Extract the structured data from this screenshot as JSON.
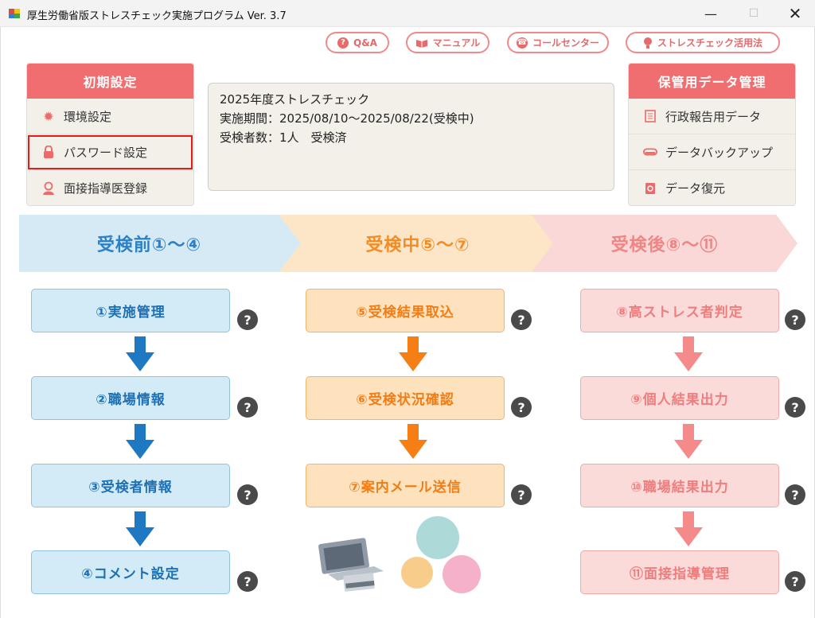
{
  "window": {
    "title": "厚生労働省版ストレスチェック実施プログラム Ver. 3.7",
    "minimize": "—",
    "maximize": "☐",
    "close": "✕"
  },
  "help_links": [
    {
      "label": "Q&A",
      "icon": "question-icon"
    },
    {
      "label": "マニュアル",
      "icon": "book-icon"
    },
    {
      "label": "コールセンター",
      "icon": "phone-icon"
    },
    {
      "label": "ストレスチェック活用法",
      "icon": "lightbulb-icon"
    }
  ],
  "initial_settings": {
    "title": "初期設定",
    "items": [
      {
        "label": "環境設定",
        "icon": "gear-icon"
      },
      {
        "label": "パスワード設定",
        "icon": "lock-icon"
      },
      {
        "label": "面接指導医登録",
        "icon": "doctor-icon"
      }
    ]
  },
  "info": {
    "line1": "2025年度ストレスチェック",
    "line2": "実施期間：2025/08/10～2025/08/22(受検中)",
    "line3": "受検者数：1人　受検済"
  },
  "data_management": {
    "title": "保管用データ管理",
    "items": [
      {
        "label": "行政報告用データ",
        "icon": "document-icon"
      },
      {
        "label": "データバックアップ",
        "icon": "drive-icon"
      },
      {
        "label": "データ復元",
        "icon": "restore-icon"
      }
    ]
  },
  "phases": [
    {
      "label": "受検前①～④",
      "color": "#2b80c6"
    },
    {
      "label": "受検中⑤～⑦",
      "color": "#f28c24"
    },
    {
      "label": "受検後⑧～⑪",
      "color": "#ee8686"
    }
  ],
  "steps": {
    "before": [
      "①実施管理",
      "②職場情報",
      "③受検者情報",
      "④コメント設定"
    ],
    "during": [
      "⑤受検結果取込",
      "⑥受検状況確認",
      "⑦案内メール送信"
    ],
    "after": [
      "⑧高ストレス者判定",
      "⑨個人結果出力",
      "⑩職場結果出力",
      "⑪面接指導管理"
    ]
  },
  "help_glyph": "?",
  "colors": {
    "accent": "#f06e70",
    "blue_arrow": "#1e78c2",
    "orange_arrow": "#f57f14",
    "pink_arrow": "#f48a8a"
  }
}
